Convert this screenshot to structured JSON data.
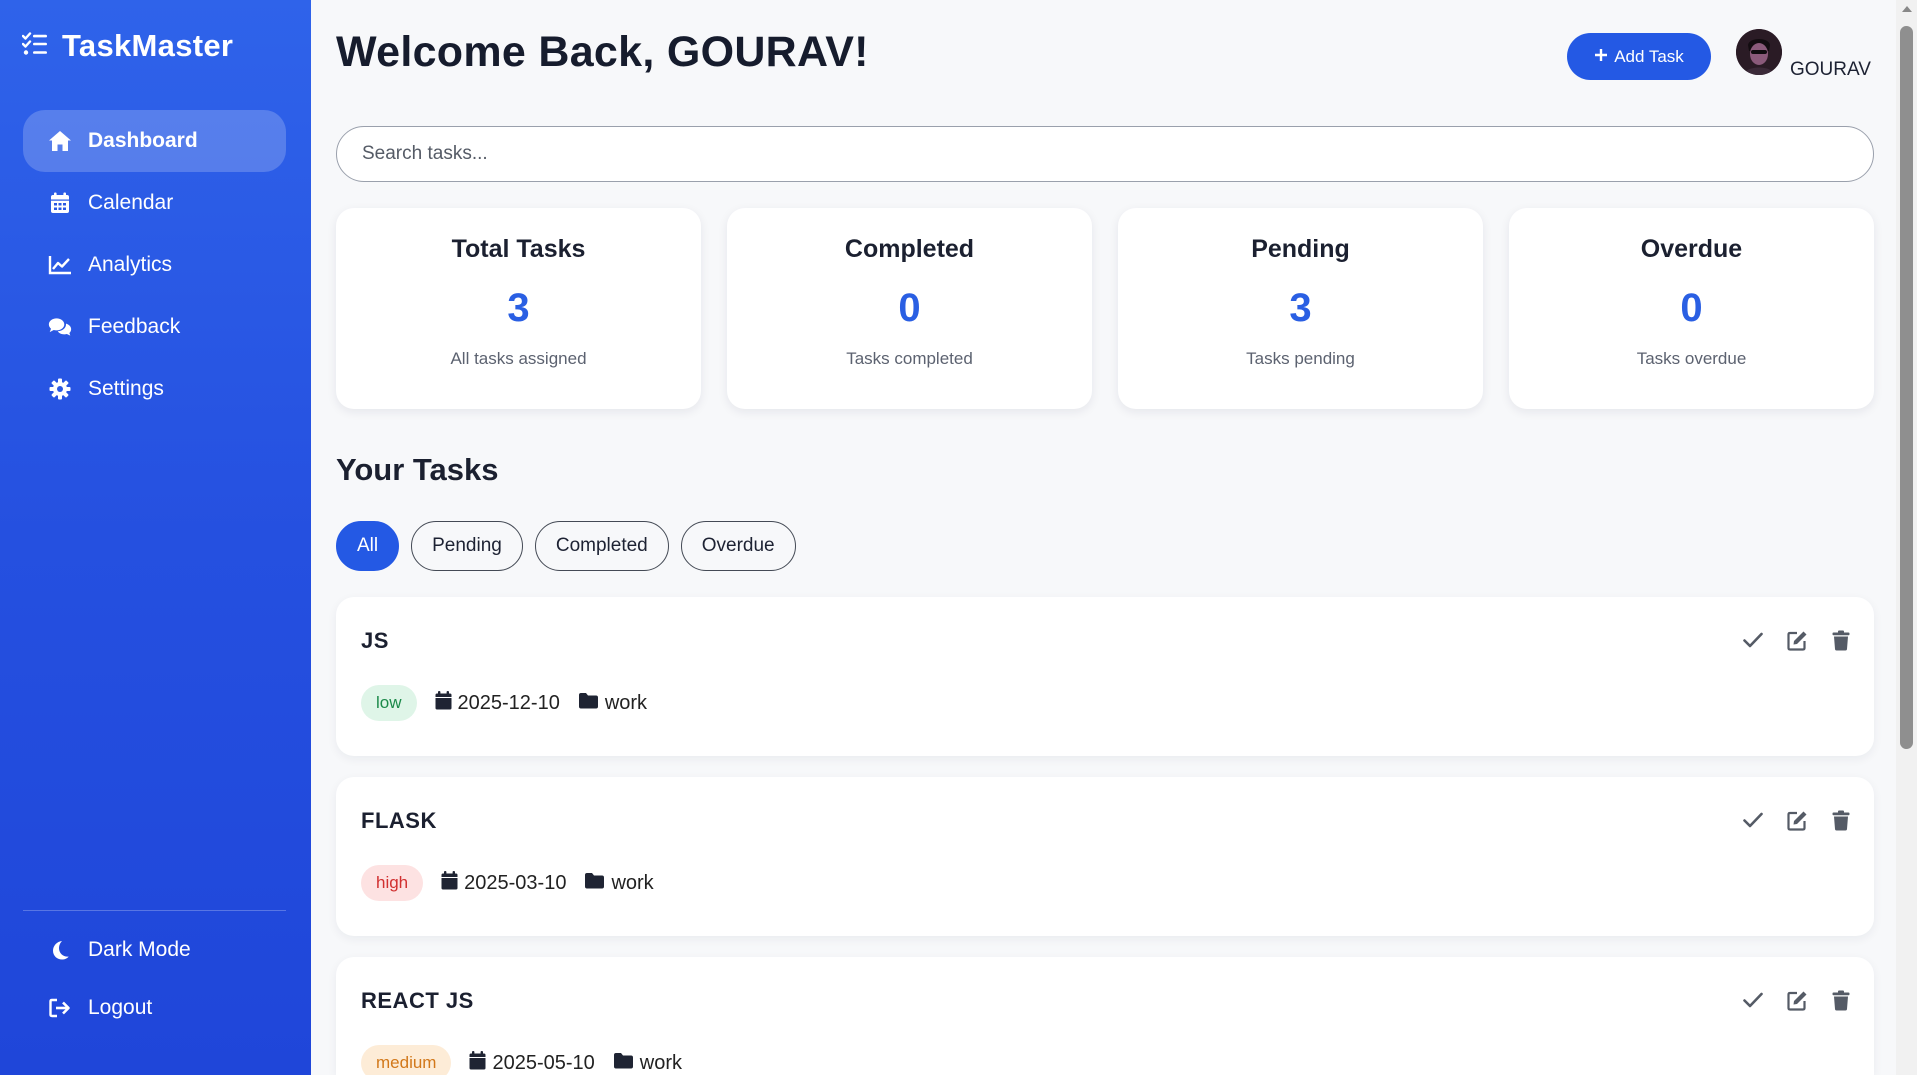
{
  "app": {
    "title": "TaskMaster",
    "accent_color": "#2459e4",
    "sidebar_color": "#2550e0"
  },
  "sidebar": {
    "items": [
      {
        "label": "Dashboard",
        "icon": "home-icon",
        "active": true
      },
      {
        "label": "Calendar",
        "icon": "calendar-icon",
        "active": false
      },
      {
        "label": "Analytics",
        "icon": "chart-line-icon",
        "active": false
      },
      {
        "label": "Feedback",
        "icon": "comments-icon",
        "active": false
      },
      {
        "label": "Settings",
        "icon": "gear-icon",
        "active": false
      }
    ],
    "bottom_items": [
      {
        "label": "Dark Mode",
        "icon": "moon-icon"
      },
      {
        "label": "Logout",
        "icon": "logout-icon"
      }
    ]
  },
  "header": {
    "welcome": "Welcome Back, GOURAV!",
    "add_task_label": "Add Task",
    "user_name": "GOURAV"
  },
  "search": {
    "placeholder": "Search tasks...",
    "value": ""
  },
  "stats": [
    {
      "title": "Total Tasks",
      "value": "3",
      "subtitle": "All tasks assigned"
    },
    {
      "title": "Completed",
      "value": "0",
      "subtitle": "Tasks completed"
    },
    {
      "title": "Pending",
      "value": "3",
      "subtitle": "Tasks pending"
    },
    {
      "title": "Overdue",
      "value": "0",
      "subtitle": "Tasks overdue"
    }
  ],
  "tasks_section": {
    "title": "Your Tasks",
    "filters": [
      {
        "label": "All",
        "active": true
      },
      {
        "label": "Pending",
        "active": false
      },
      {
        "label": "Completed",
        "active": false
      },
      {
        "label": "Overdue",
        "active": false
      }
    ],
    "tasks": [
      {
        "title": "JS",
        "priority": "low",
        "date": "2025-12-10",
        "category": "work"
      },
      {
        "title": "FLASK",
        "priority": "high",
        "date": "2025-03-10",
        "category": "work"
      },
      {
        "title": "REACT JS",
        "priority": "medium",
        "date": "2025-05-10",
        "category": "work"
      }
    ]
  }
}
